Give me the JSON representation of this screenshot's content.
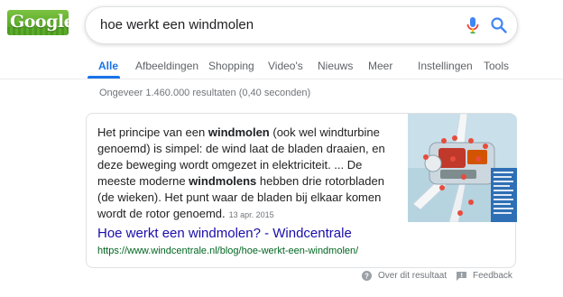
{
  "logo": {
    "text": "Google"
  },
  "search": {
    "query": "hoe werkt een windmolen"
  },
  "tabs": [
    {
      "label": "Alle",
      "active": true
    },
    {
      "label": "Afbeeldingen"
    },
    {
      "label": "Shopping"
    },
    {
      "label": "Video's"
    },
    {
      "label": "Nieuws"
    },
    {
      "label": "Meer"
    },
    {
      "label": "Instellingen"
    },
    {
      "label": "Tools"
    }
  ],
  "stats": "Ongeveer 1.460.000 resultaten (0,40 seconden)",
  "snippet": {
    "p1": "Het principe van een ",
    "b1": "windmolen",
    "p2": " (ook wel windturbine genoemd) is simpel: de wind laat de bladen draaien, en deze beweging wordt omgezet in elektriciteit. ... De meeste moderne ",
    "b2": "windmolens",
    "p3": " hebben drie rotorbladen (de wieken). Het punt waar de bladen bij elkaar komen wordt de rotor genoemd.",
    "date": "13 apr. 2015"
  },
  "result": {
    "title": "Hoe werkt een windmolen? - Windcentrale",
    "url": "https://www.windcentrale.nl/blog/hoe-werkt-een-windmolen/"
  },
  "footer": {
    "about": "Over dit resultaat",
    "feedback": "Feedback"
  },
  "colors": {
    "link": "#1a0dab",
    "url": "#006621",
    "accent": "#1a73e8"
  },
  "icons": [
    "microphone-icon",
    "search-icon",
    "help-icon",
    "feedback-icon"
  ]
}
